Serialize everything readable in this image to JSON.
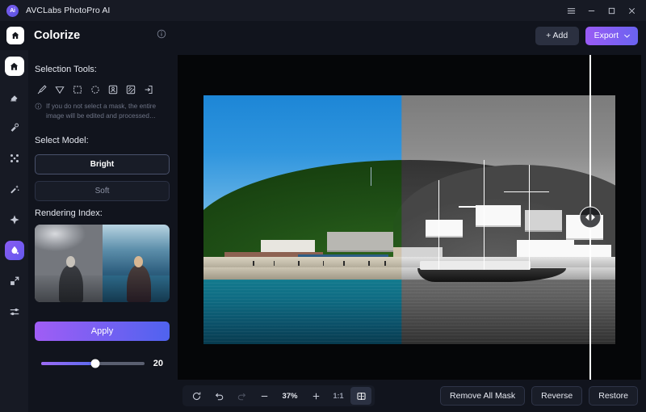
{
  "titlebar": {
    "logo_text": "Ai",
    "app_title": "AVCLabs PhotoPro AI",
    "menu_icon": "hamburger-menu-icon",
    "minimize_icon": "minimize-icon",
    "maximize_icon": "maximize-icon",
    "close_icon": "close-icon"
  },
  "header": {
    "home_icon": "home-icon",
    "page_title": "Colorize",
    "info_icon": "info-circle-icon",
    "add_label": "+ Add",
    "export_label": "Export",
    "export_caret": "chevron-down-icon",
    "accent_gradient_from": "#9a5bf5",
    "accent_gradient_to": "#6a63f0"
  },
  "rail": {
    "items": [
      {
        "icon": "home-icon",
        "active": false
      },
      {
        "icon": "eraser-icon",
        "active": false
      },
      {
        "icon": "magic-enhance-icon",
        "active": false
      },
      {
        "icon": "denoise-dots-icon",
        "active": false
      },
      {
        "icon": "retouch-wand-icon",
        "active": false
      },
      {
        "icon": "sharpen-icon",
        "active": false
      },
      {
        "icon": "colorize-drop-icon",
        "active": true
      },
      {
        "icon": "upscale-expand-icon",
        "active": false
      },
      {
        "icon": "adjust-sliders-icon",
        "active": false
      }
    ]
  },
  "panel": {
    "selection_tools_label": "Selection Tools:",
    "tools": [
      {
        "name": "brush-tool-icon"
      },
      {
        "name": "lasso-pointer-tool-icon"
      },
      {
        "name": "rectangle-select-tool-icon"
      },
      {
        "name": "ellipse-select-tool-icon"
      },
      {
        "name": "subject-select-tool-icon"
      },
      {
        "name": "background-select-tool-icon"
      },
      {
        "name": "invert-selection-tool-icon"
      }
    ],
    "hint_icon": "info-circle-icon",
    "hint_text": "If you do not select a mask, the entire image will be edited and processed…",
    "select_model_label": "Select Model:",
    "models": [
      {
        "label": "Bright",
        "selected": true
      },
      {
        "label": "Soft",
        "selected": false
      }
    ],
    "rendering_index_label": "Rendering Index:",
    "rendering_index_value": "20",
    "apply_label": "Apply"
  },
  "canvas": {
    "compare_handle_icon": "compare-left-right-arrows-icon",
    "divider_position_label": "split-divider"
  },
  "bottombar": {
    "reset_icon": "reset-rotate-icon",
    "undo_icon": "undo-icon",
    "redo_icon": "redo-icon",
    "zoom_out_icon": "minus-icon",
    "zoom_level": "37%",
    "zoom_in_icon": "plus-icon",
    "fit_ratio_label": "1:1",
    "compare_view_icon": "split-compare-view-icon",
    "remove_all_mask_label": "Remove All Mask",
    "reverse_label": "Reverse",
    "restore_label": "Restore"
  }
}
